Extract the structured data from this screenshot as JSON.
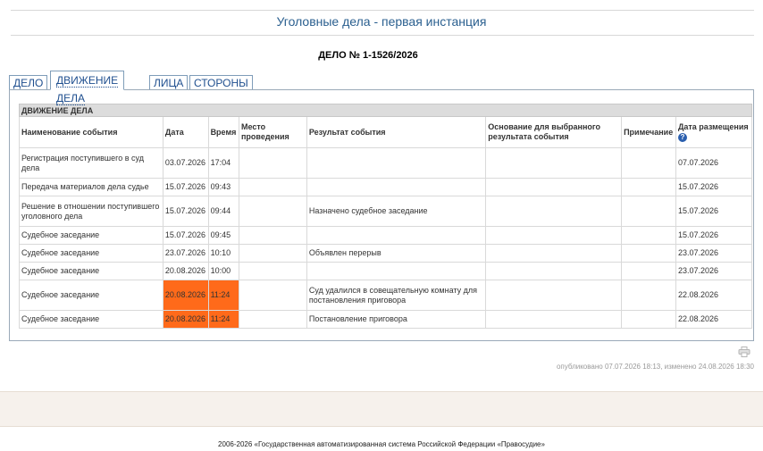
{
  "page": {
    "title": "Уголовные дела - первая инстанция",
    "case_number": "ДЕЛО № 1-1526/2026"
  },
  "tabs": [
    {
      "label": "ДЕЛО",
      "active": false
    },
    {
      "label": "ДВИЖЕНИЕ ДЕЛА",
      "active": true
    },
    {
      "label": "ЛИЦА",
      "active": false
    },
    {
      "label": "СТОРОНЫ",
      "active": false
    }
  ],
  "table": {
    "section_title": "ДВИЖЕНИЕ ДЕЛА",
    "headers": {
      "event": "Наименование события",
      "date": "Дата",
      "time": "Время",
      "place": "Место проведения",
      "result": "Результат события",
      "basis": "Основание для выбранного результата события",
      "note": "Примечание",
      "posted": "Дата размещения"
    },
    "rows": [
      {
        "event": "Регистрация поступившего в суд дела",
        "date": "03.07.2026",
        "time": "17:04",
        "place": "",
        "result": "",
        "basis": "",
        "note": "",
        "posted": "07.07.2026"
      },
      {
        "event": "Передача материалов дела судье",
        "date": "15.07.2026",
        "time": "09:43",
        "place": "",
        "result": "",
        "basis": "",
        "note": "",
        "posted": "15.07.2026"
      },
      {
        "event": "Решение в отношении поступившего уголовного дела",
        "date": "15.07.2026",
        "time": "09:44",
        "place": "",
        "result": "Назначено судебное заседание",
        "basis": "",
        "note": "",
        "posted": "15.07.2026"
      },
      {
        "event": "Судебное заседание",
        "date": "15.07.2026",
        "time": "09:45",
        "place": "",
        "result": "",
        "basis": "",
        "note": "",
        "posted": "15.07.2026"
      },
      {
        "event": "Судебное заседание",
        "date": "23.07.2026",
        "time": "10:10",
        "place": "",
        "result": "Объявлен перерыв",
        "basis": "",
        "note": "",
        "posted": "23.07.2026"
      },
      {
        "event": "Судебное заседание",
        "date": "20.08.2026",
        "time": "10:00",
        "place": "",
        "result": "",
        "basis": "",
        "note": "",
        "posted": "23.07.2026"
      },
      {
        "event": "Судебное заседание",
        "date": "20.08.2026",
        "time": "11:24",
        "place": "",
        "result": "Суд удалился в совещательную комнату для постановления приговора",
        "basis": "",
        "note": "",
        "posted": "22.08.2026",
        "highlight": true
      },
      {
        "event": "Судебное заседание",
        "date": "20.08.2026",
        "time": "11:24",
        "place": "",
        "result": "Постановление приговора",
        "basis": "",
        "note": "",
        "posted": "22.08.2026",
        "highlight": true
      }
    ]
  },
  "icons": {
    "help": "help-icon",
    "print": "print-icon"
  },
  "footer": {
    "published": "опубликовано 07.07.2026 18:13, изменено 24.08.2026 18:30",
    "copyright": "2006-2026 «Государственная автоматизированная система Российской Федерации «Правосудие»"
  },
  "colors": {
    "highlight": "#ff6a1a",
    "title": "#2a5f8f",
    "section_header_bg": "#dcdcdc"
  }
}
